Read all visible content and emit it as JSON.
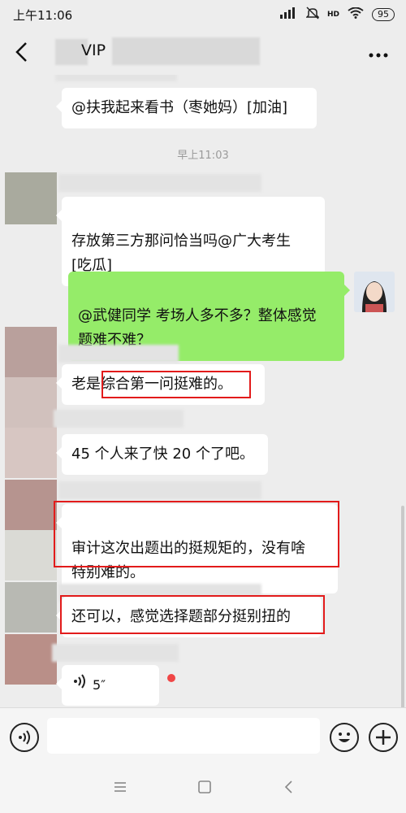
{
  "status_bar": {
    "time": "上午11:06",
    "network": "HD",
    "battery": "95"
  },
  "header": {
    "title_suffix": "VIP"
  },
  "messages": [
    {
      "text": "@扶我起来看书（枣她妈）[加油]"
    },
    {
      "timestamp": "早上11:03"
    },
    {
      "text": "存放第三方那问恰当吗@广大考生\n[吃瓜]"
    },
    {
      "text": "@武健同学 考场人多不多？整体感觉\n题难不难？"
    },
    {
      "text": "老是综合第一问挺难的。"
    },
    {
      "text": "45 个人来了快 20 个了吧。"
    },
    {
      "text": "审计这次出题出的挺规矩的，没有啥\n特别难的。"
    },
    {
      "text": "还可以，感觉选择题部分挺别扭的"
    },
    {
      "voice_duration": "5″"
    }
  ],
  "icons": {
    "back": "chevron-left-icon",
    "more": "more-icon",
    "voice_input": "voice-icon",
    "emoji": "emoji-icon",
    "plus": "plus-icon",
    "nav_menu": "menu-icon",
    "nav_home": "home-icon",
    "nav_back": "back-icon"
  },
  "colors": {
    "self_bubble": "#95ec69",
    "highlight": "#e21b1b",
    "background": "#ededed"
  }
}
